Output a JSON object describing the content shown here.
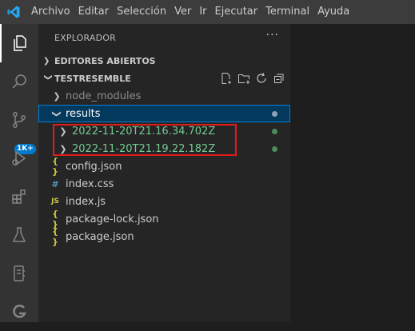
{
  "menu": [
    "Archivo",
    "Editar",
    "Selección",
    "Ver",
    "Ir",
    "Ejecutar",
    "Terminal",
    "Ayuda"
  ],
  "activity": {
    "badge": "1K+"
  },
  "explorer": {
    "title": "EXPLORADOR",
    "more": "···",
    "open_editors": "EDITORES ABIERTOS",
    "workspace": "TESTRESEMBLE",
    "tree": {
      "node_modules": "node_modules",
      "results": "results",
      "result_1": "2022-11-20T21.16.34.702Z",
      "result_2": "2022-11-20T21.19.22.182Z",
      "config": "config.json",
      "index_css": "index.css",
      "index_js": "index.js",
      "package_lock": "package-lock.json",
      "package": "package.json"
    },
    "icons": {
      "json": "{ }",
      "css": "#",
      "js": "JS"
    }
  },
  "colors": {
    "accent": "#007acc",
    "green_text": "#73c991",
    "json_icon": "#cbcb41",
    "css_icon": "#519aba",
    "highlight": "#e01b1b"
  }
}
